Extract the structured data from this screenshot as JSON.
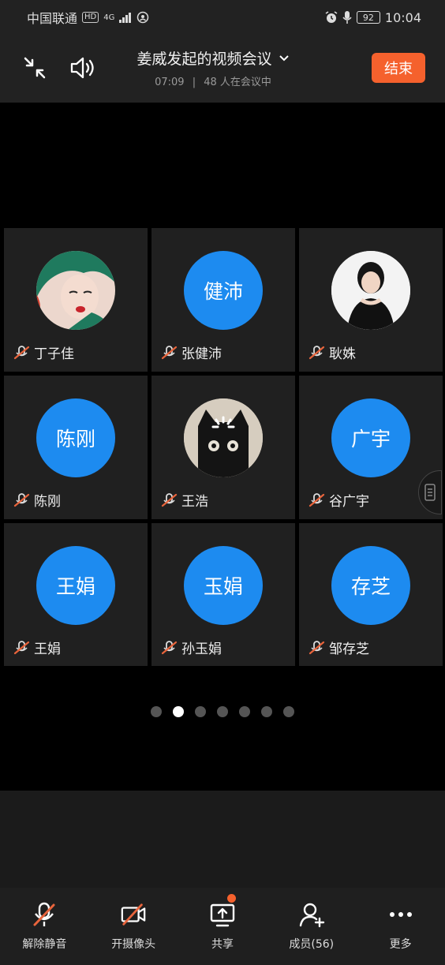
{
  "status_bar": {
    "carrier": "中国联通",
    "hd": "HD",
    "network": "4G",
    "battery": "92",
    "time": "10:04"
  },
  "header": {
    "title": "姜威发起的视频会议",
    "duration": "07:09",
    "separator": "|",
    "participants_text": "48 人在会议中",
    "end_label": "结束"
  },
  "participants": [
    {
      "name": "丁子佳",
      "avatar_text": "",
      "avatar_type": "photo"
    },
    {
      "name": "张健沛",
      "avatar_text": "健沛",
      "avatar_type": "initials"
    },
    {
      "name": "耿姝",
      "avatar_text": "",
      "avatar_type": "photo"
    },
    {
      "name": "陈刚",
      "avatar_text": "陈刚",
      "avatar_type": "initials"
    },
    {
      "name": "王浩",
      "avatar_text": "",
      "avatar_type": "photo-loading"
    },
    {
      "name": "谷广宇",
      "avatar_text": "广宇",
      "avatar_type": "initials"
    },
    {
      "name": "王娟",
      "avatar_text": "王娟",
      "avatar_type": "initials"
    },
    {
      "name": "孙玉娟",
      "avatar_text": "玉娟",
      "avatar_type": "initials"
    },
    {
      "name": "邹存芝",
      "avatar_text": "存芝",
      "avatar_type": "initials"
    }
  ],
  "pagination": {
    "total_pages": 7,
    "current_page": 2
  },
  "toolbar": [
    {
      "label": "解除静音",
      "icon": "mic-muted-icon"
    },
    {
      "label": "开摄像头",
      "icon": "camera-off-icon"
    },
    {
      "label": "共享",
      "icon": "share-screen-icon",
      "notification": true
    },
    {
      "label": "成员(56)",
      "icon": "add-member-icon"
    },
    {
      "label": "更多",
      "icon": "more-icon"
    }
  ],
  "colors": {
    "accent": "#f5612d",
    "avatar_blue": "#1d8bf0",
    "mute_red": "#e8643c"
  }
}
